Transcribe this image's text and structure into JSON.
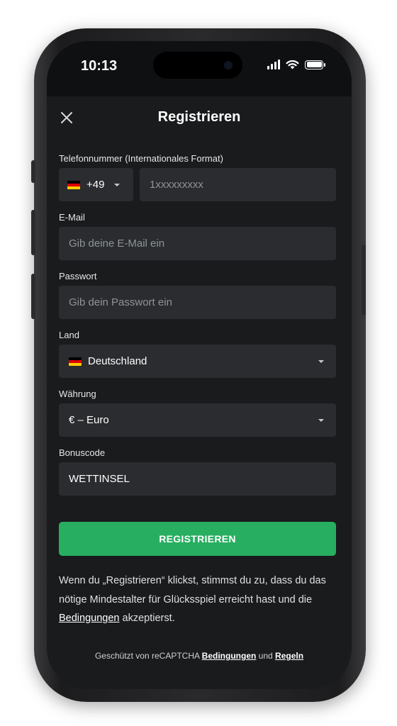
{
  "status_bar": {
    "time": "10:13"
  },
  "header": {
    "title": "Registrieren",
    "close_icon": "close-icon"
  },
  "phone": {
    "label": "Telefonnummer (Internationales Format)",
    "country_code": "+49",
    "placeholder": "1xxxxxxxxx"
  },
  "email": {
    "label": "E-Mail",
    "placeholder": "Gib deine E-Mail ein"
  },
  "password": {
    "label": "Passwort",
    "placeholder": "Gib dein Passwort ein"
  },
  "country": {
    "label": "Land",
    "value": "Deutschland"
  },
  "currency": {
    "label": "Währung",
    "value": "€ – Euro"
  },
  "bonus": {
    "label": "Bonuscode",
    "value": "WETTINSEL"
  },
  "submit": {
    "label": "REGISTRIEREN",
    "color": "#27ae60"
  },
  "terms": {
    "text_before": "Wenn du „Registrieren“ klickst, stimmst du zu, dass du das nötige Mindestalter für Glücksspiel erreicht hast und die ",
    "link": "Bedingungen",
    "text_after": " akzeptierst."
  },
  "footer": {
    "prefix": "Geschützt von reCAPTCHA ",
    "link_terms": "Bedingungen",
    "and": " und ",
    "link_rules": "Regeln"
  },
  "colors": {
    "background": "#1a1b1d",
    "field": "#2a2c2f",
    "accent": "#27ae60"
  }
}
